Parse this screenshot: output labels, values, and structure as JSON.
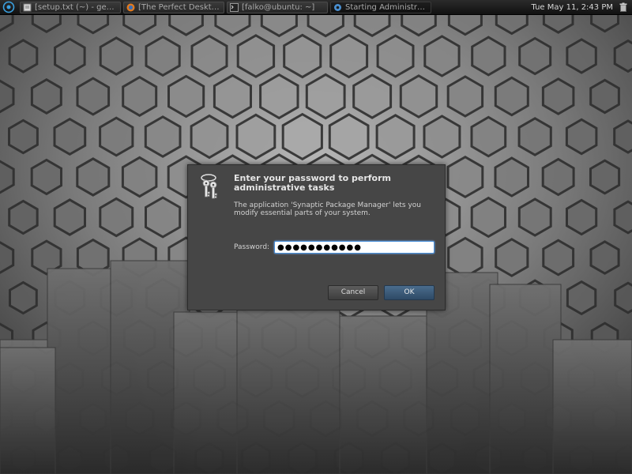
{
  "panel": {
    "tasks": [
      {
        "label": "[setup.txt (~) - gedit]",
        "icon": "text-editor-icon"
      },
      {
        "label": "[The Perfect Desktop - ...",
        "icon": "firefox-icon"
      },
      {
        "label": "[falko@ubuntu: ~]",
        "icon": "terminal-icon"
      },
      {
        "label": "Starting Administrativ...",
        "icon": "gear-icon"
      }
    ],
    "clock": "Tue May 11,  2:43 PM"
  },
  "dialog": {
    "title": "Enter your password to perform administrative tasks",
    "message": "The application 'Synaptic Package Manager' lets you modify essential parts of your system.",
    "password_label": "Password:",
    "password_value": "●●●●●●●●●●●",
    "cancel_label": "Cancel",
    "ok_label": "OK"
  }
}
